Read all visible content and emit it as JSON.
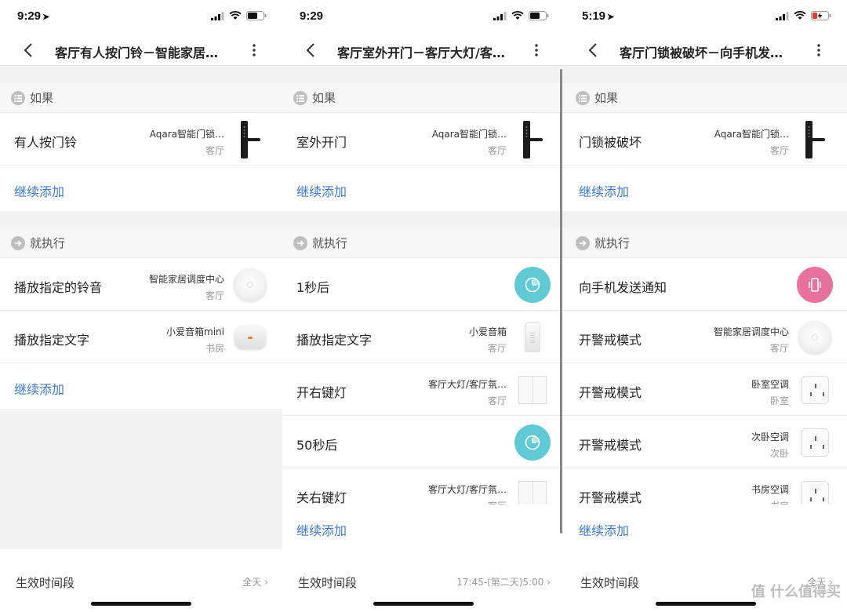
{
  "panels": [
    {
      "status_time": "9:29",
      "title": "客厅有人按门铃－智能家居…",
      "if_label": "如果",
      "if_rows": [
        {
          "title": "有人按门铃",
          "device": "Aqara智能门锁…",
          "room": "客厅",
          "icon": "door-lock"
        }
      ],
      "add_label": "继续添加",
      "then_label": "就执行",
      "then_rows": [
        {
          "title": "播放指定的铃音",
          "device": "智能家居调度中心",
          "room": "客厅",
          "icon": "hub"
        },
        {
          "title": "播放指定文字",
          "device": "小爱音箱mini",
          "room": "书房",
          "icon": "speaker-mini"
        }
      ],
      "then_add_label": "继续添加",
      "footer_label": "生效时间段",
      "footer_value": "全天"
    },
    {
      "status_time": "9:29",
      "title": "客厅室外开门－客厅大灯/客…",
      "if_label": "如果",
      "if_rows": [
        {
          "title": "室外开门",
          "device": "Aqara智能门锁…",
          "room": "客厅",
          "icon": "door-lock"
        }
      ],
      "add_label": "继续添加",
      "then_label": "就执行",
      "then_rows": [
        {
          "title": "1秒后",
          "device": "",
          "room": "",
          "icon": "timer"
        },
        {
          "title": "播放指定文字",
          "device": "小爱音箱",
          "room": "客厅",
          "icon": "speaker"
        },
        {
          "title": "开右键灯",
          "device": "客厅大灯/客厅氛…",
          "room": "客厅",
          "icon": "wall-switch"
        },
        {
          "title": "50秒后",
          "device": "",
          "room": "",
          "icon": "timer"
        },
        {
          "title": "关右键灯",
          "device": "客厅大灯/客厅氛…",
          "room": "客厅",
          "icon": "wall-switch"
        }
      ],
      "then_add_label": "继续添加",
      "footer_label": "生效时间段",
      "footer_value": "17:45-(第二天)5:00"
    },
    {
      "status_time": "5:19",
      "title": "客厅门锁被破坏－向手机发…",
      "if_label": "如果",
      "if_rows": [
        {
          "title": "门锁被破坏",
          "device": "Aqara智能门锁…",
          "room": "客厅",
          "icon": "door-lock"
        }
      ],
      "add_label": "继续添加",
      "then_label": "就执行",
      "then_rows": [
        {
          "title": "向手机发送通知",
          "device": "",
          "room": "",
          "icon": "phone-notify"
        },
        {
          "title": "开警戒模式",
          "device": "智能家居调度中心",
          "room": "客厅",
          "icon": "hub"
        },
        {
          "title": "开警戒模式",
          "device": "卧室空调",
          "room": "卧室",
          "icon": "ac-plug"
        },
        {
          "title": "开警戒模式",
          "device": "次卧空调",
          "room": "次卧",
          "icon": "ac-plug"
        },
        {
          "title": "开警戒模式",
          "device": "书房空调",
          "room": "书房",
          "icon": "ac-plug"
        }
      ],
      "then_add_label": "继续添加",
      "footer_label": "生效时间段",
      "footer_value": "全天"
    }
  ],
  "watermark": "值 什么值得买"
}
